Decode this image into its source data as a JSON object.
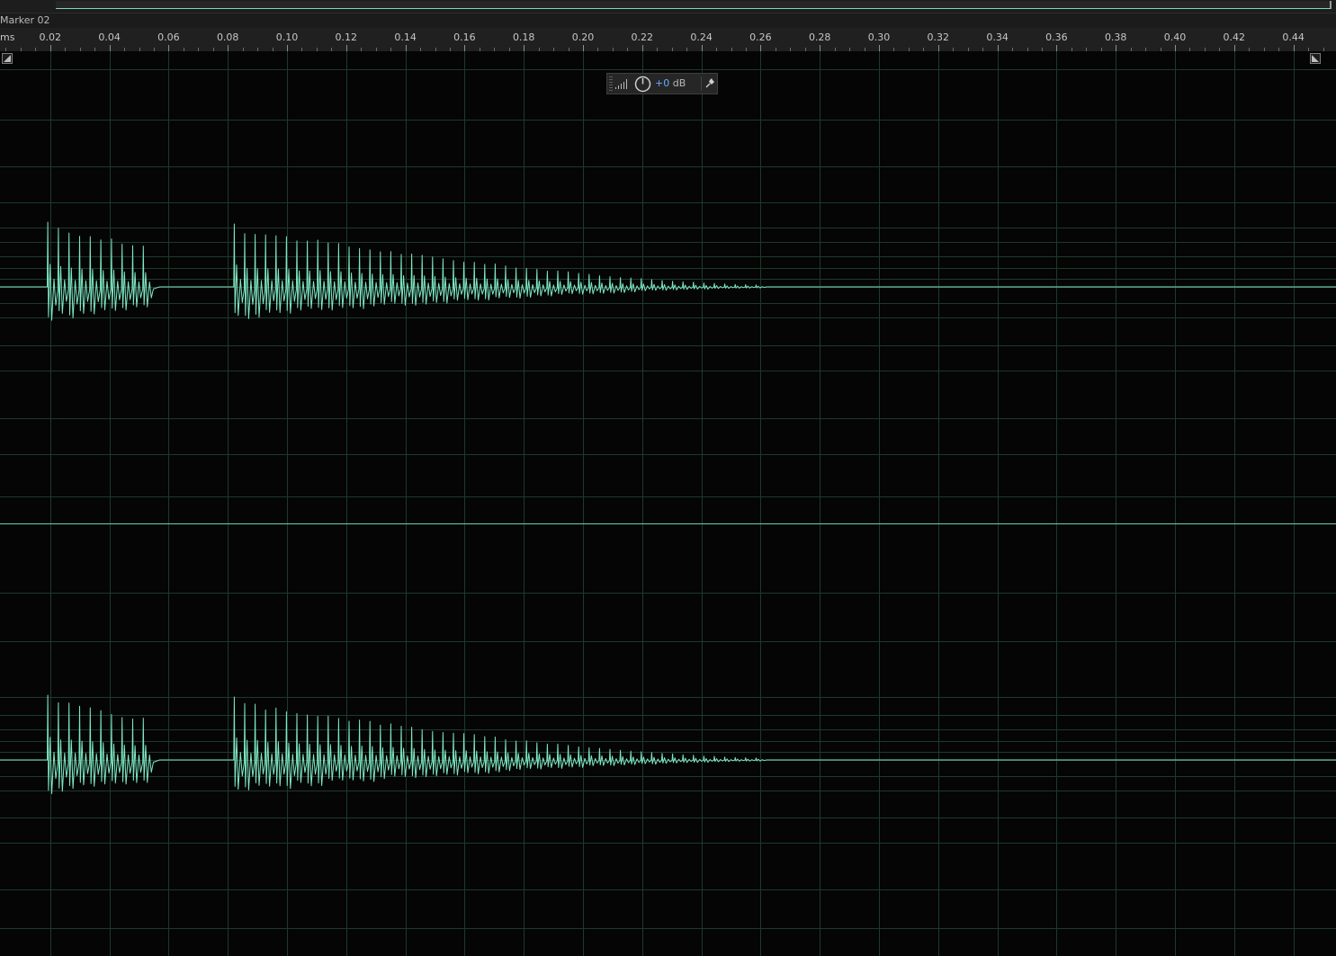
{
  "overview": {
    "label": ""
  },
  "marker": {
    "label": "Marker 02"
  },
  "ruler": {
    "unit_label": "ms",
    "ticks": [
      "0.02",
      "0.04",
      "0.06",
      "0.08",
      "0.10",
      "0.12",
      "0.14",
      "0.16",
      "0.18",
      "0.20",
      "0.22",
      "0.24",
      "0.26",
      "0.28",
      "0.30",
      "0.32",
      "0.34",
      "0.36",
      "0.38",
      "0.40",
      "0.42",
      "0.44"
    ]
  },
  "hud": {
    "gain_value": "+0",
    "gain_unit": " dB"
  },
  "waveform": {
    "channels": 2,
    "bursts_ms": [
      {
        "start": 0.019,
        "end": 0.057
      },
      {
        "start": 0.082,
        "end": 0.262
      }
    ],
    "colors": {
      "wave": "#7ee8c3",
      "grid": "#1c3a2c",
      "background": "#050505",
      "ruler_bg": "#202020"
    }
  },
  "icons": {
    "meter": "signal-bars-icon",
    "knob": "gain-knob-icon",
    "pin": "pin-icon",
    "zoom_left": "zoom-corner-left-icon",
    "zoom_right": "zoom-corner-right-icon"
  }
}
